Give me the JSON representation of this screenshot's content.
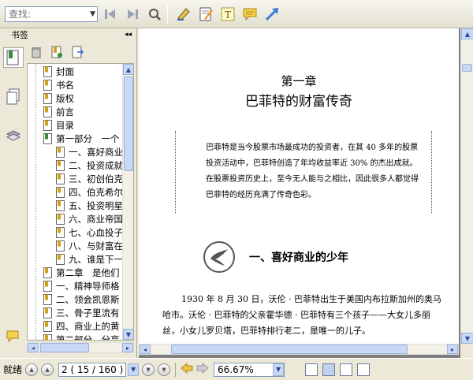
{
  "toolbar": {
    "search_placeholder": "查找:",
    "buttons": [
      "find-previous-icon",
      "find-next-icon",
      "find-all-icon",
      "highlight-icon",
      "note-icon",
      "text-icon",
      "comment-icon",
      "arrow-icon"
    ]
  },
  "sidebar": {
    "title": "书签",
    "collapse": "◂◂",
    "bookmarks": [
      {
        "label": "封面",
        "indent": 0
      },
      {
        "label": "书名",
        "indent": 0
      },
      {
        "label": "版权",
        "indent": 0
      },
      {
        "label": "前言",
        "indent": 0
      },
      {
        "label": "目录",
        "indent": 0
      },
      {
        "label": "第一部分　一个",
        "indent": 0,
        "green": true
      },
      {
        "label": "一、喜好商业",
        "indent": 1
      },
      {
        "label": "二、投资成就",
        "indent": 1
      },
      {
        "label": "三、初创伯克",
        "indent": 1
      },
      {
        "label": "四、伯克希尔",
        "indent": 1
      },
      {
        "label": "五、投资明星",
        "indent": 1
      },
      {
        "label": "六、商业帝国",
        "indent": 1
      },
      {
        "label": "七、心血投子",
        "indent": 1
      },
      {
        "label": "八、与财富在",
        "indent": 1
      },
      {
        "label": "九、谁是下一",
        "indent": 1
      },
      {
        "label": "第二章　是他们",
        "indent": 0
      },
      {
        "label": "一、精神导师格",
        "indent": 0
      },
      {
        "label": "二、领会凯恩斯",
        "indent": 0
      },
      {
        "label": "三、骨子里流有",
        "indent": 0
      },
      {
        "label": "四、商业上的黄",
        "indent": 0
      },
      {
        "label": "第二部分　分享",
        "indent": 0
      }
    ]
  },
  "document": {
    "chapter_number": "第一章",
    "chapter_title": "巴菲特的财富传奇",
    "quote": "巴菲特是当今股票市场最成功的投资者，在其 40 多年的股票投资活动中，巴菲特创造了年均收益率近 30% 的杰出成就。在股票投资历史上，至今无人能与之相比，因此很多人都觉得巴菲特的经历充满了传奇色彩。",
    "section_title": "一、喜好商业的少年",
    "body": "1930 年 8 月 30 日，沃伦 · 巴菲特出生于美国内布拉斯加州的奥马哈市。沃伦 · 巴菲特的父亲霍华德 · 巴菲特有三个孩子——大女儿多丽丝，小女儿罗贝塔，巴菲特排行老二，是唯一的儿子。"
  },
  "status": {
    "ready": "就绪",
    "page_text": "2 ( 15 / 160 )",
    "zoom": "66.67%"
  }
}
